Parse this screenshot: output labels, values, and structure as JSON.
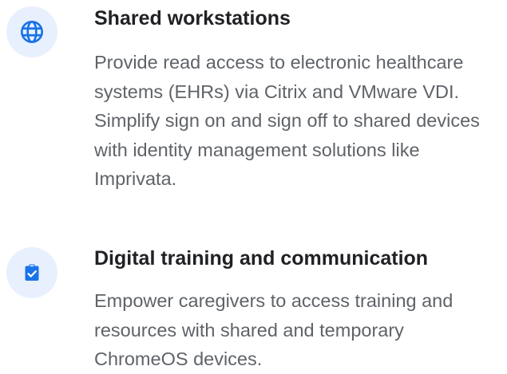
{
  "features": [
    {
      "icon": "globe-icon",
      "title": "Shared workstations",
      "description": "Provide read access to electronic healthcare systems (EHRs) via Citrix and VMware VDI. Simplify sign on and sign off to shared devices with identity management solutions like Imprivata."
    },
    {
      "icon": "clipboard-check-icon",
      "title": "Digital training and communication",
      "description": "Empower caregivers to access training and resources with shared and temporary ChromeOS devices."
    }
  ],
  "colors": {
    "icon_bg": "#e8f0fe",
    "icon_fg": "#1a73e8",
    "title": "#202124",
    "body": "#5f6368"
  }
}
